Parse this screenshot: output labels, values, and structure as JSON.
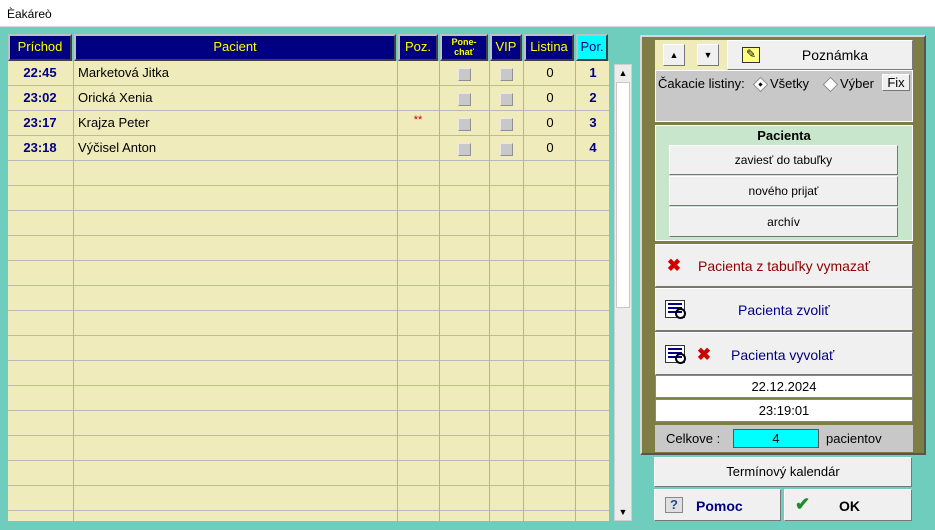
{
  "window": {
    "title": "Èakáreò"
  },
  "table": {
    "headers": {
      "arrival": "Príchod",
      "patient": "Pacient",
      "note": "Poz.",
      "keep_line1": "Pone-",
      "keep_line2": "chať",
      "vip": "VIP",
      "list": "Listina",
      "order": "Por."
    },
    "rows": [
      {
        "arrival": "22:45",
        "patient": "Marketová Jitka",
        "note": "",
        "list": "0",
        "order": "1"
      },
      {
        "arrival": "23:02",
        "patient": "Orická Xenia",
        "note": "",
        "list": "0",
        "order": "2"
      },
      {
        "arrival": "23:17",
        "patient": "Krajza Peter",
        "note": "**",
        "list": "0",
        "order": "3"
      },
      {
        "arrival": "23:18",
        "patient": "Výčisel Anton",
        "note": "",
        "list": "0",
        "order": "4"
      }
    ]
  },
  "panel": {
    "note_button": "Poznámka",
    "waiting_lists_label": "Čakacie listiny:",
    "radio_all": "Všetky",
    "radio_selection": "Výber",
    "fix_button": "Fix",
    "patient_group_title": "Pacienta",
    "add_to_table": "zaviesť do tabuľky",
    "admit_new": "nového prijať",
    "archive": "archív",
    "remove_patient": "Pacienta z tabuľky vymazať",
    "select_patient": "Pacienta zvoliť",
    "call_patient": "Pacienta vyvolať",
    "date": "22.12.2024",
    "time": "23:19:01",
    "total_label": "Celkove :",
    "total_value": "4",
    "total_unit": "pacientov"
  },
  "footer": {
    "calendar": "Termínový kalendár",
    "help": "Pomoc",
    "ok": "OK"
  },
  "colors": {
    "background": "#6ecdbd",
    "header": "#000080",
    "header_text": "#ffff00",
    "table_body": "#efebbb",
    "panel": "#7d7d45",
    "counter": "#00ffff"
  }
}
